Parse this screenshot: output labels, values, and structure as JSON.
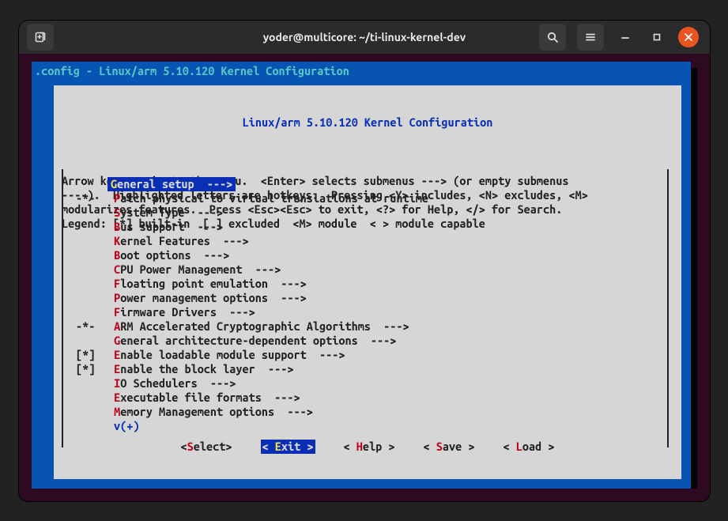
{
  "window": {
    "title": "yoder@multicore: ~/ti-linux-kernel-dev"
  },
  "config_line": ".config - Linux/arm 5.10.120 Kernel Configuration",
  "panel": {
    "title": "Linux/arm 5.10.120 Kernel Configuration",
    "help1": "Arrow keys navigate the menu.  <Enter> selects submenus ---> (or empty submenus",
    "help2": "----).  Highlighted letters are hotkeys.  Pressing <Y> includes, <N> excludes, <M>",
    "help3": "modularizes features.  Press <Esc><Esc> to exit, <?> for Help, </> for Search.",
    "help4": "Legend: [*] built-in  [ ] excluded  <M> module  < > module capable"
  },
  "menu": [
    {
      "mark": "   ",
      "hot": "G",
      "rest": "eneral setup  --->",
      "selected": true
    },
    {
      "mark": "-*-",
      "hot": "P",
      "rest": "atch physical to virtual translations at runtime"
    },
    {
      "mark": "   ",
      "hot": "S",
      "rest": "ystem Type  --->"
    },
    {
      "mark": "   ",
      "hot": "B",
      "rest": "us support  --->"
    },
    {
      "mark": "   ",
      "hot": "K",
      "rest": "ernel Features  --->"
    },
    {
      "mark": "   ",
      "hot": "B",
      "rest": "oot options  --->"
    },
    {
      "mark": "   ",
      "hot": "C",
      "rest": "PU Power Management  --->"
    },
    {
      "mark": "   ",
      "hot": "F",
      "rest": "loating point emulation  --->"
    },
    {
      "mark": "   ",
      "hot": "P",
      "rest": "ower management options  --->"
    },
    {
      "mark": "   ",
      "hot": "F",
      "rest": "irmware Drivers  --->"
    },
    {
      "mark": "-*-",
      "hot": "A",
      "rest": "RM Accelerated Cryptographic Algorithms  --->"
    },
    {
      "mark": "   ",
      "hot": "G",
      "rest": "eneral architecture-dependent options  --->"
    },
    {
      "mark": "[*]",
      "hot": "E",
      "rest": "nable loadable module support  --->"
    },
    {
      "mark": "[*]",
      "hot": "E",
      "rest": "nable the block layer  --->"
    },
    {
      "mark": "   ",
      "hot": "I",
      "rest": "O Schedulers  --->"
    },
    {
      "mark": "   ",
      "hot": "E",
      "rest": "xecutable file formats  --->"
    },
    {
      "mark": "   ",
      "hot": "M",
      "rest": "emory Management options  --->"
    }
  ],
  "more_indicator": "v(+)",
  "buttons": {
    "select": {
      "pre": "<",
      "hot": "S",
      "rest": "elect>"
    },
    "exit": {
      "pre": "< ",
      "hot": "E",
      "rest": "xit >"
    },
    "help": {
      "pre": "< ",
      "hot": "H",
      "rest": "elp >"
    },
    "save": {
      "pre": "< ",
      "hot": "S",
      "rest": "ave >"
    },
    "load": {
      "pre": "< ",
      "hot": "L",
      "rest": "oad >"
    }
  },
  "active_button": "exit"
}
